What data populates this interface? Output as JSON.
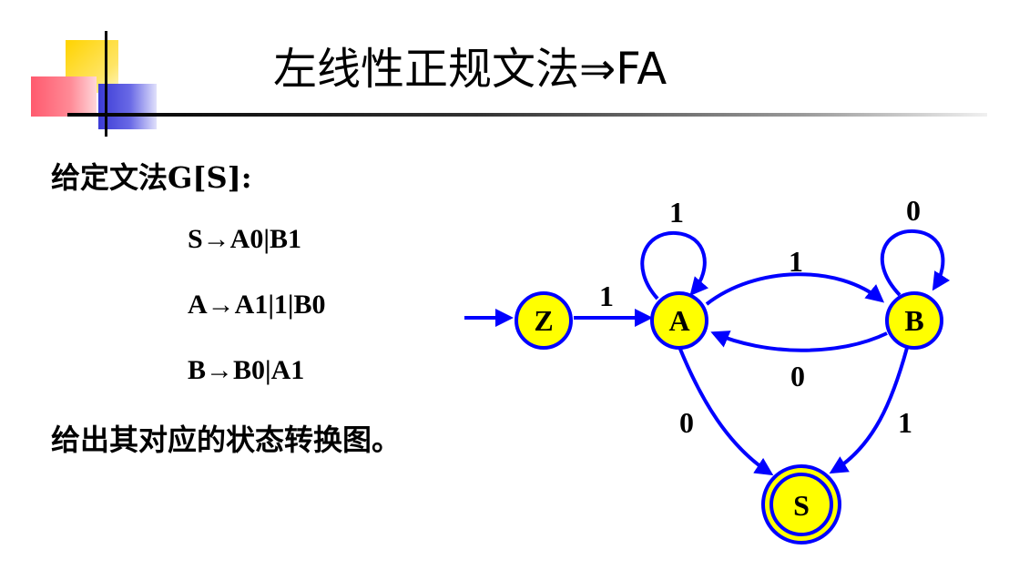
{
  "title": "左线性正规文法⇒FA",
  "intro": "给定文法G[S]:",
  "rules": [
    "S→A0|B1",
    "A→A1|1|B0",
    "B→B0|A1"
  ],
  "question": "给出其对应的状态转换图。",
  "colors": {
    "state_fill": "#ffff00",
    "edge": "#0000ff",
    "label": "#000000"
  },
  "diagram": {
    "states": [
      {
        "id": "Z",
        "label": "Z",
        "initial": true
      },
      {
        "id": "A",
        "label": "A"
      },
      {
        "id": "B",
        "label": "B"
      },
      {
        "id": "S",
        "label": "S",
        "accepting": true
      }
    ],
    "transitions": [
      {
        "from": "Z",
        "to": "A",
        "symbol": "1"
      },
      {
        "from": "A",
        "to": "A",
        "symbol": "1"
      },
      {
        "from": "A",
        "to": "B",
        "symbol": "1"
      },
      {
        "from": "B",
        "to": "A",
        "symbol": "0"
      },
      {
        "from": "B",
        "to": "B",
        "symbol": "0"
      },
      {
        "from": "A",
        "to": "S",
        "symbol": "0"
      },
      {
        "from": "B",
        "to": "S",
        "symbol": "1"
      }
    ]
  }
}
